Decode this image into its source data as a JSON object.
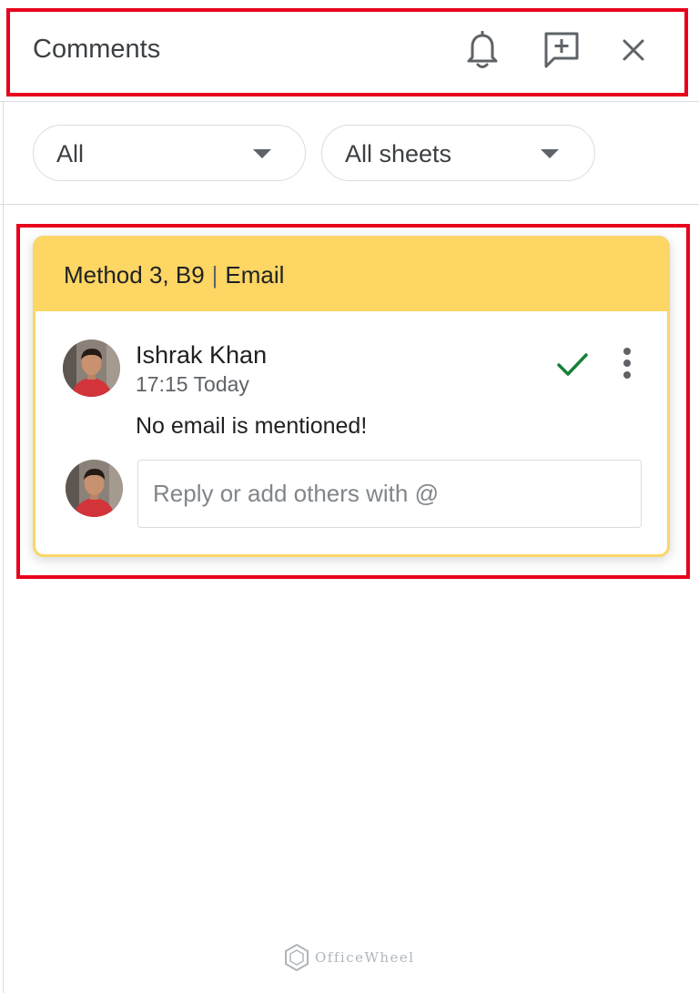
{
  "header": {
    "title": "Comments",
    "icons": [
      "bell-icon",
      "add-comment-icon",
      "close-icon"
    ]
  },
  "filters": [
    {
      "label": "All",
      "icon": "caret-down-icon"
    },
    {
      "label": "All sheets",
      "icon": "caret-down-icon"
    }
  ],
  "comment": {
    "reference": "Method 3, B9",
    "separator": "|",
    "field": "Email",
    "author": "Ishrak Khan",
    "time": "17:15 Today",
    "text": "No email is mentioned!",
    "resolve_icon": "checkmark-icon",
    "more_icon": "more-vert-icon",
    "reply_placeholder": "Reply or add others with @"
  },
  "watermark": "OfficeWheel",
  "colors": {
    "card_header": "#fdd663",
    "card_border": "#fbd668",
    "highlight": "#e8001c",
    "resolve": "#188038"
  }
}
